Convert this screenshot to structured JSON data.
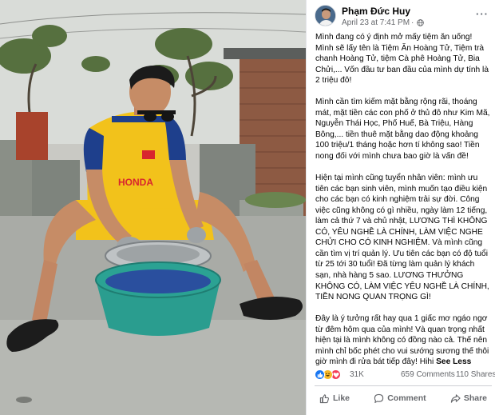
{
  "post": {
    "author": "Phạm Đức Huy",
    "timestamp": "April 23 at 7:41 PM",
    "paragraphs": [
      "Mình đang có ý định mở mấy tiệm ăn uống! Mình sẽ lấy tên là Tiệm Ăn Hoàng Tử, Tiệm trà chanh Hoàng Tử, tiệm Cà phê Hoàng Tử, Bia Chửi,... Vốn đầu tư ban đầu của mình dự tính là 2 triệu đô!",
      "Mình cần tìm kiếm mặt bằng rộng rãi, thoáng mát, mặt tiền các con phố ở thủ đô như Kim Mã, Nguyễn Thái Học, Phố Huế, Bà Triệu, Hàng Bông,... tiền thuê mặt bằng dao động khoảng 100 triệu/1 tháng hoặc hơn tí không sao! Tiền nong đối với mình chưa bao giờ là vấn đề!",
      "Hiện tại mình cũng tuyển nhân viên: mình ưu tiên các bạn sinh viên, mình muốn tạo điều kiện cho các bạn có kinh nghiệm trải sự đời. Công việc cũng không có gì nhiều, ngày làm 12 tiếng, làm cả thứ 7 và chủ nhật, LƯƠNG THÌ KHÔNG CÓ, YÊU NGHỀ LÀ CHÍNH, LÀM VIỆC NGHE CHỬI CHO CÓ KINH NGHIỆM. Và mình cũng cần tìm vị trí quản lý. Ưu tiên các bạn có độ tuổi từ 25 tới 30 tuổi! Đã từng làm quản lý khách sạn, nhà hàng 5 sao. LƯƠNG THƯỞNG KHÔNG CÓ, LÀM VIỆC YÊU NGHỀ LÀ CHÍNH, TIỀN NONG QUAN TRỌNG GÌ!",
      "Đây là ý tưởng rất hay qua 1 giấc mơ ngáo ngơ từ đêm hôm qua của mình! Và quan trọng nhất hiện tại là mình không có đồng nào cả. Thế nên mình chỉ bốc phét cho vui sướng sương thế thôi giờ mình đi rửa bát tiếp đây! Hihi"
    ],
    "see_less_label": "See Less"
  },
  "reactions": {
    "icons": [
      "like-icon",
      "haha-icon",
      "love-icon"
    ],
    "count": "31K",
    "comments": "659 Comments",
    "shares": "110 Shares"
  },
  "actions": {
    "like": "Like",
    "comment": "Comment",
    "share": "Share"
  },
  "colors": {
    "like": "#1877f2",
    "haha": "#f7b928",
    "love": "#f33e58",
    "secondary_text": "#65676b",
    "jersey_yellow": "#f2c21b",
    "jersey_blue": "#1e3f8c",
    "basin": "#2a9d8f"
  }
}
